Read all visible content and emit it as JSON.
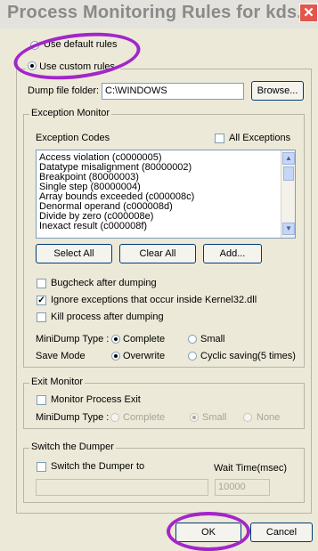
{
  "window": {
    "title": "Process Monitoring Rules for kds...",
    "close_glyph": "✕"
  },
  "rules": {
    "default_label": "Use default rules",
    "custom_label": "Use custom rules",
    "selected": "custom"
  },
  "dump_folder": {
    "label": "Dump file folder:",
    "value": "C:\\WINDOWS",
    "browse_label": "Browse..."
  },
  "exception_monitor": {
    "title": "Exception Monitor",
    "codes_label": "Exception Codes",
    "all_exceptions_label": "All Exceptions",
    "all_exceptions_checked": false,
    "codes": [
      "Access violation (c0000005)",
      "Datatype misalignment (80000002)",
      "Breakpoint (80000003)",
      "Single step (80000004)",
      "Array bounds exceeded (c000008c)",
      "Denormal operand (c000008d)",
      "Divide by zero (c000008e)",
      "Inexact result (c000008f)"
    ],
    "select_all_label": "Select All",
    "clear_all_label": "Clear All",
    "add_label": "Add...",
    "bugcheck_label": "Bugcheck after dumping",
    "bugcheck_checked": false,
    "ignore_label": "Ignore exceptions that occur inside Kernel32.dll",
    "ignore_checked": true,
    "kill_label": "Kill process after dumping",
    "kill_checked": false,
    "minidump_label": "MiniDump Type :",
    "minidump_complete": "Complete",
    "minidump_small": "Small",
    "minidump_selected": "Complete",
    "save_mode_label": "Save Mode",
    "save_overwrite": "Overwrite",
    "save_cyclic": "Cyclic saving(5 times)",
    "save_selected": "Overwrite"
  },
  "exit_monitor": {
    "title": "Exit Monitor",
    "monitor_exit_label": "Monitor Process Exit",
    "monitor_exit_checked": false,
    "minidump_label": "MiniDump Type :",
    "complete": "Complete",
    "small": "Small",
    "none": "None",
    "selected": "Small"
  },
  "switch_dumper": {
    "title": "Switch the Dumper",
    "switch_label": "Switch the Dumper to",
    "switch_checked": false,
    "wait_label": "Wait Time(msec)",
    "path_value": "",
    "wait_value": "10000"
  },
  "buttons": {
    "ok_label": "OK",
    "cancel_label": "Cancel"
  },
  "colors": {
    "annotation": "#a226c9",
    "dialog_bg": "#ece9d8"
  }
}
